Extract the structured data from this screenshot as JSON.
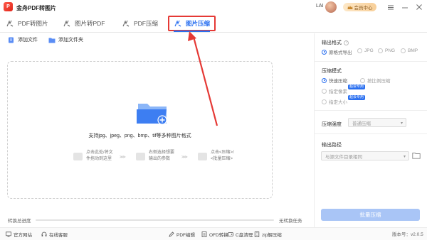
{
  "app": {
    "title": "金舟PDF转图片",
    "logo_glyph": "P",
    "user_name": "LAI",
    "vip_label": "会员中心",
    "vip_icon": "crown-icon",
    "window_controls": [
      "menu-icon",
      "minimize-icon",
      "close-icon"
    ],
    "version_label": "版本号：v2.0.5"
  },
  "tabs": [
    {
      "label": "PDF转图片",
      "icon": "pdf-to-image-icon",
      "active": false
    },
    {
      "label": "图片转PDF",
      "icon": "image-to-pdf-icon",
      "active": false
    },
    {
      "label": "PDF压缩",
      "icon": "pdf-compress-icon",
      "active": false
    },
    {
      "label": "图片压缩",
      "icon": "image-compress-icon",
      "active": true
    }
  ],
  "toolbar": {
    "add_file_label": "添加文件",
    "add_folder_label": "添加文件夹"
  },
  "dropzone": {
    "hint": "支持jpg、jpeg、png、bmp、tif等多种图片格式",
    "steps": [
      {
        "line1": "点击此处/将文",
        "line2": "件拖动到这里",
        "icon": "file-drop-icon"
      },
      {
        "line1": "右侧选择想要",
        "line2": "输出的参数",
        "icon": "settings-panel-icon"
      },
      {
        "line1": "点击<压缩>/",
        "line2": "<批量压缩>",
        "icon": "compress-action-icon"
      }
    ],
    "step_arrow": ">>>"
  },
  "progress": {
    "label": "转换总进度",
    "value": 0,
    "right_label": "无转换任务"
  },
  "right_panel": {
    "output_format": {
      "title": "输出格式",
      "options": [
        "原格式导出",
        "JPG",
        "PNG",
        "BMP"
      ],
      "selected": "原格式导出"
    },
    "compress_mode": {
      "title": "压缩模式",
      "options": [
        "快速压缩",
        "按比例压缩",
        "指定像素",
        "指定大小"
      ],
      "selected": "快速压缩",
      "member_badge": "超会专用"
    },
    "compress_strength": {
      "title": "压缩强度",
      "value": "普通压缩"
    },
    "output_path": {
      "title": "输出路径",
      "value": "与源文件目录相同"
    },
    "batch_button": "批量压缩"
  },
  "bottom_bar": {
    "official_site": "官方网站",
    "online_service": "在线客服",
    "links": [
      "PDF编辑",
      "OFD转换",
      "C盘清理",
      "zip解压缩"
    ]
  }
}
